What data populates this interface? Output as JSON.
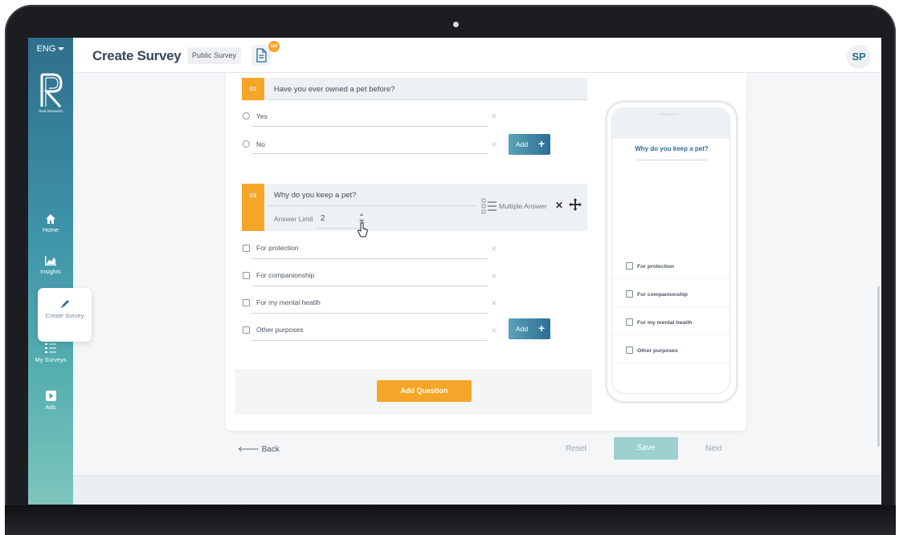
{
  "topbar": {
    "language": "ENG",
    "page_title": "Create Survey",
    "survey_type": "Public Survey",
    "doc_badge": "110",
    "avatar_initials": "SP"
  },
  "sidebar": {
    "logo_text": "Real Research",
    "items": [
      {
        "label": "Home",
        "icon": "home-icon"
      },
      {
        "label": "Insights",
        "icon": "chart-icon"
      },
      {
        "label": "Create Survey",
        "icon": "pencil-icon",
        "active": true
      },
      {
        "label": "My Surveys",
        "icon": "list-icon"
      },
      {
        "label": "Ads",
        "icon": "play-icon"
      }
    ]
  },
  "questions": [
    {
      "number": "02",
      "text": "Have you ever owned a pet before?",
      "options": [
        "Yes",
        "No"
      ],
      "add_label": "Add"
    },
    {
      "number": "03",
      "text": "Why do you keep a pet?",
      "answer_limit_label": "Answer Limit",
      "answer_limit_value": "2",
      "answer_type": "Multiple Answer",
      "options": [
        "For protection",
        "For companionship",
        "For my mental heatlh",
        "Other purposes"
      ],
      "add_label": "Add"
    }
  ],
  "add_question_label": "Add Question",
  "preview": {
    "question": "Why do you keep a pet?",
    "options": [
      "For protection",
      "For companionship",
      "For my mental heatlh",
      "Other purposes"
    ]
  },
  "footer": {
    "back_label": "Back",
    "reset_label": "Reset",
    "save_label": "Save",
    "next_label": "Next"
  },
  "colors": {
    "accent_orange": "#f5a628",
    "brand_blue": "#2d6e93",
    "save_teal": "#9bd0cf"
  }
}
